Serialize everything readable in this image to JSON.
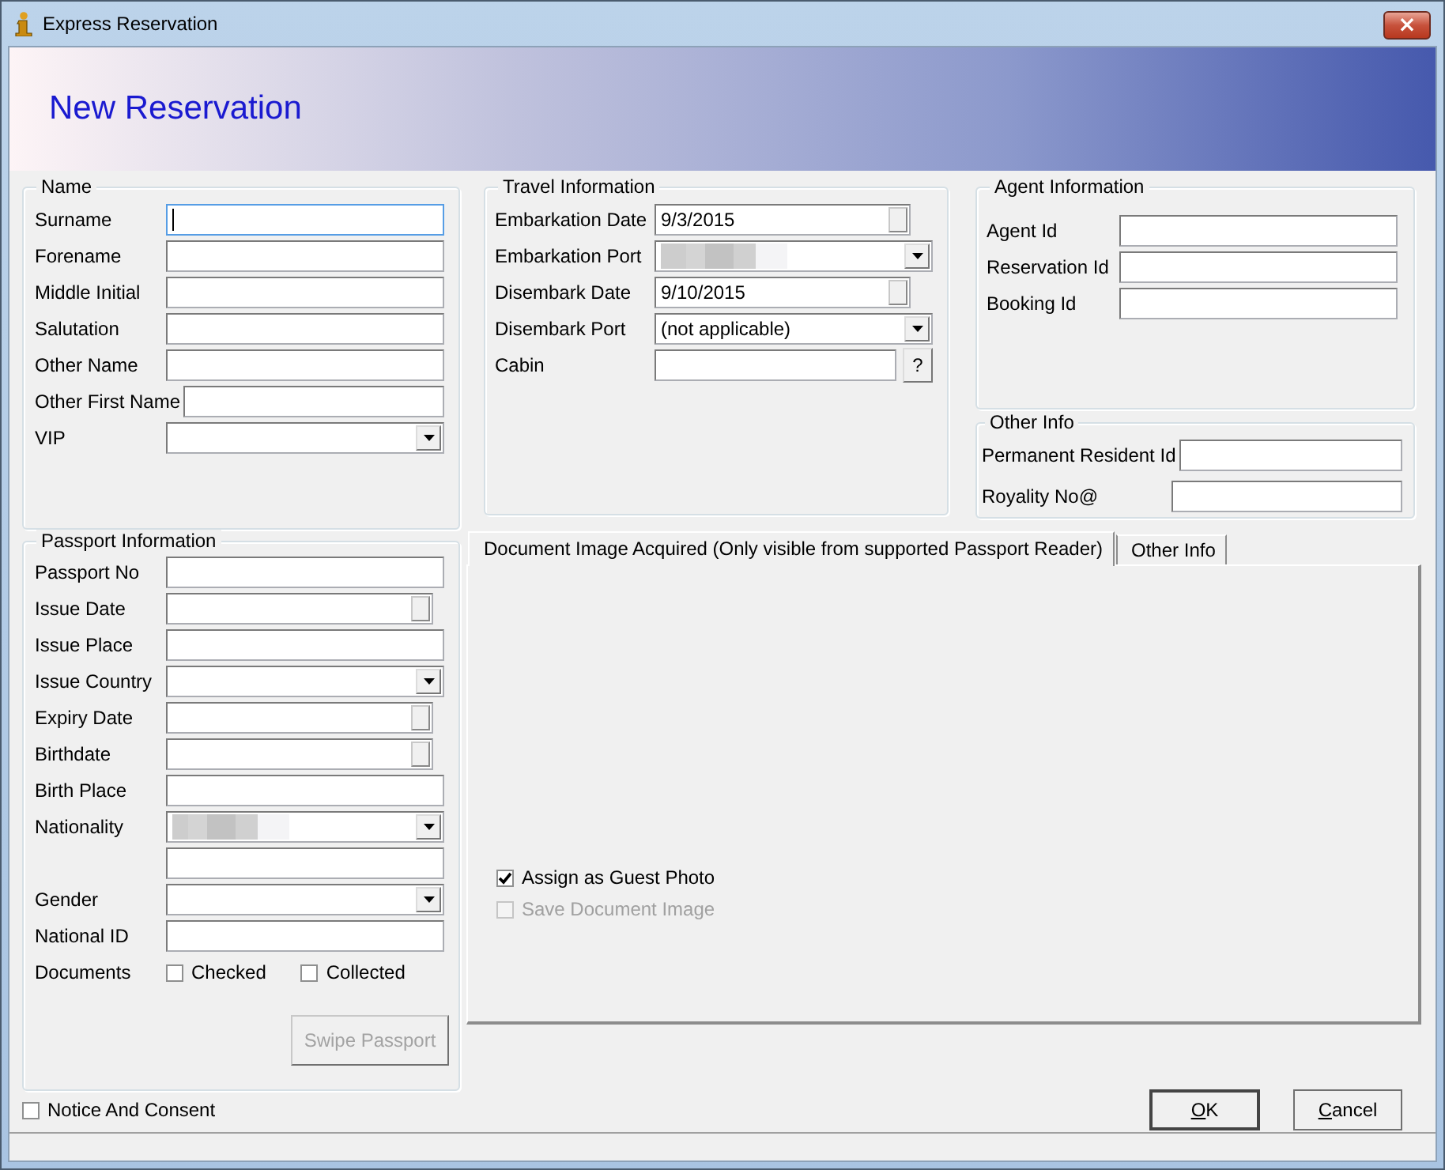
{
  "window": {
    "title": "Express Reservation",
    "close": "×"
  },
  "banner": {
    "title": "New Reservation"
  },
  "name": {
    "title": "Name",
    "fields": [
      {
        "label": "Surname",
        "kind": "text",
        "focused": true
      },
      {
        "label": "Forename",
        "kind": "text",
        "focused": false
      },
      {
        "label": "Middle Initial",
        "kind": "text",
        "focused": false
      },
      {
        "label": "Salutation",
        "kind": "text",
        "focused": false
      },
      {
        "label": "Other Name",
        "kind": "text",
        "focused": false
      },
      {
        "label": "Other First Name",
        "kind": "text",
        "focused": false
      },
      {
        "label": "VIP",
        "kind": "combo",
        "focused": false
      }
    ]
  },
  "travel": {
    "title": "Travel Information",
    "fields": [
      {
        "label": "Embarkation Date",
        "kind": "date",
        "value": "9/3/2015"
      },
      {
        "label": "Embarkation Port",
        "kind": "combo",
        "redacted": true
      },
      {
        "label": "Disembark Date",
        "kind": "date",
        "value": "9/10/2015"
      },
      {
        "label": "Disembark Port",
        "kind": "combo",
        "value": "(not applicable)"
      },
      {
        "label": "Cabin",
        "kind": "lookup",
        "button": "?"
      }
    ]
  },
  "agent": {
    "title": "Agent Information",
    "fields": [
      {
        "label": "Agent Id",
        "kind": "text"
      },
      {
        "label": "Reservation Id",
        "kind": "text"
      },
      {
        "label": "Booking Id",
        "kind": "text"
      }
    ]
  },
  "other_info": {
    "title": "Other Info",
    "fields": [
      {
        "label": "Permanent Resident Id",
        "kind": "text"
      },
      {
        "label": "Royality No@",
        "kind": "text"
      }
    ]
  },
  "passport": {
    "title": "Passport Information",
    "fields": [
      {
        "label": "Passport No",
        "kind": "text"
      },
      {
        "label": "Issue Date",
        "kind": "date"
      },
      {
        "label": "Issue Place",
        "kind": "text"
      },
      {
        "label": "Issue Country",
        "kind": "combo"
      },
      {
        "label": "Expiry Date",
        "kind": "date"
      },
      {
        "label": "Birthdate",
        "kind": "date"
      },
      {
        "label": "Birth Place",
        "kind": "text"
      },
      {
        "label": "Nationality",
        "kind": "combo",
        "redacted": true
      },
      {
        "kind": "text"
      },
      {
        "label": "Gender",
        "kind": "combo"
      },
      {
        "label": "National ID",
        "kind": "text"
      },
      {
        "label": "Documents",
        "kind": "checks",
        "options": [
          {
            "label": "Checked",
            "checked": false
          },
          {
            "label": "Collected",
            "checked": false
          }
        ]
      }
    ],
    "swipe_button": {
      "label": "Swipe Passport",
      "disabled": true
    }
  },
  "tabs": [
    {
      "label": "Document Image Acquired (Only visible from supported Passport Reader)",
      "selected": true
    },
    {
      "label": "Other Info",
      "selected": false
    }
  ],
  "tab_panel": {
    "checkboxes": [
      {
        "label": "Assign as Guest Photo",
        "checked": true,
        "disabled": false
      },
      {
        "label": "Save Document Image",
        "checked": false,
        "disabled": true
      }
    ]
  },
  "notice": {
    "label": "Notice And Consent",
    "checked": false
  },
  "buttons": [
    {
      "label": "OK",
      "default": true
    },
    {
      "label": "Cancel",
      "default": false
    }
  ]
}
